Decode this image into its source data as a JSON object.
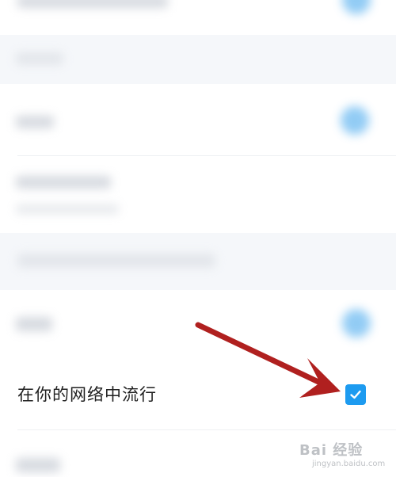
{
  "settings": {
    "trending_in_network": {
      "label": "在你的网络中流行",
      "checked": true
    }
  },
  "colors": {
    "checkbox": "#1d9bf0",
    "arrow": "#b0201f",
    "text": "#1f1f1f",
    "divider": "#eef0f3"
  },
  "watermark": {
    "logo": "Bai 经验",
    "subtitle": "jingyan.baidu.com"
  }
}
